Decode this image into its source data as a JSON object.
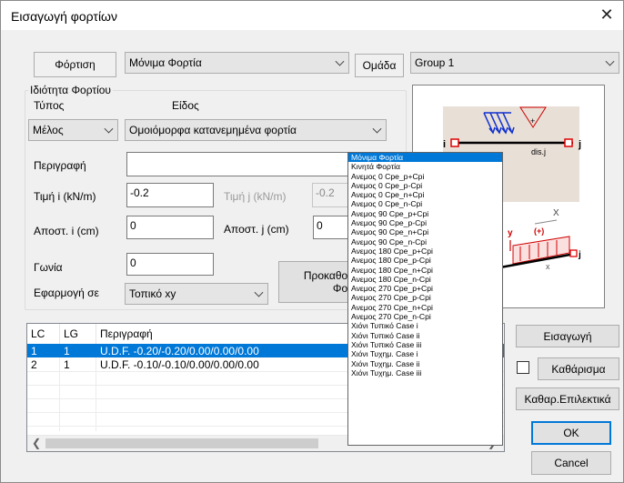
{
  "window": {
    "title": "Εισαγωγή φορτίων"
  },
  "top": {
    "loading_tab": "Φόρτιση",
    "loading_value": "Μόνιμα Φορτία",
    "group_tab": "Ομάδα",
    "group_value": "Group 1"
  },
  "props": {
    "group_title": "Ιδιότητα Φορτίου",
    "type_label": "Τύπος",
    "kind_label": "Είδος",
    "type_value": "Μέλος",
    "kind_value": "Ομοιόμορφα κατανεμημένα φορτία",
    "description_label": "Περιγραφή",
    "description_value": "",
    "value_i_label": "Τιμή i (kN/m)",
    "value_i": "-0.2",
    "value_j_label": "Τιμή j (kN/m)",
    "value_j": "-0.2",
    "dist_i_label": "Αποστ. i (cm)",
    "dist_i": "0",
    "dist_j_label": "Αποστ. j (cm)",
    "dist_j": "0",
    "angle_label": "Γωνία",
    "angle": "0",
    "apply_label": "Εφαρμογή σε",
    "apply_value": "Τοπικό xy",
    "predefined_line1": "Προκαθορ",
    "predefined_line2": "Φορ"
  },
  "picture": {
    "node_i": "i",
    "node_j": "j",
    "dis_label": "dis.j",
    "axis_x": "X",
    "axis_y": "y",
    "plus": "(+)",
    "local_x": "x"
  },
  "list": {
    "headers": [
      "LC",
      "LG",
      "Περιγραφή"
    ],
    "rows": [
      {
        "lc": "1",
        "lg": "1",
        "desc": "U.D.F.  -0.20/-0.20/0.00/0.00/0.00"
      },
      {
        "lc": "2",
        "lg": "1",
        "desc": "U.D.F.  -0.10/-0.10/0.00/0.00/0.00"
      }
    ]
  },
  "buttons": {
    "insert": "Εισαγωγή",
    "clear": "Καθάρισμα",
    "clear_selective": "Καθαρ.Επιλεκτικά",
    "ok": "OK",
    "cancel": "Cancel"
  },
  "dropdown": {
    "items": [
      "Μόνιμα Φορτία",
      "Κινητά Φορτία",
      "Ανεμος 0 Cpe_p+Cpi",
      "Ανεμος 0 Cpe_p-Cpi",
      "Ανεμος 0 Cpe_n+Cpi",
      "Ανεμος 0 Cpe_n-Cpi",
      "Ανεμος 90 Cpe_p+Cpi",
      "Ανεμος 90 Cpe_p-Cpi",
      "Ανεμος 90 Cpe_n+Cpi",
      "Ανεμος 90 Cpe_n-Cpi",
      "Ανεμος 180 Cpe_p+Cpi",
      "Ανεμος 180 Cpe_p-Cpi",
      "Ανεμος 180 Cpe_n+Cpi",
      "Ανεμος 180 Cpe_n-Cpi",
      "Ανεμος 270 Cpe_p+Cpi",
      "Ανεμος 270 Cpe_p-Cpi",
      "Ανεμος 270 Cpe_n+Cpi",
      "Ανεμος 270 Cpe_n-Cpi",
      "Χιόνι Τυπικό Case i",
      "Χιόνι Τυπικό Case ii",
      "Χιόνι Τυπικό Case iii",
      "Χιόνι Τυχημ. Case i",
      "Χιόνι Τυχημ. Case ii",
      "Χιόνι Τυχημ. Case iii"
    ],
    "selected_index": 0
  },
  "colors": {
    "accent": "#0078d7",
    "node": "#e00000",
    "load_arrow": "#1030d0"
  }
}
